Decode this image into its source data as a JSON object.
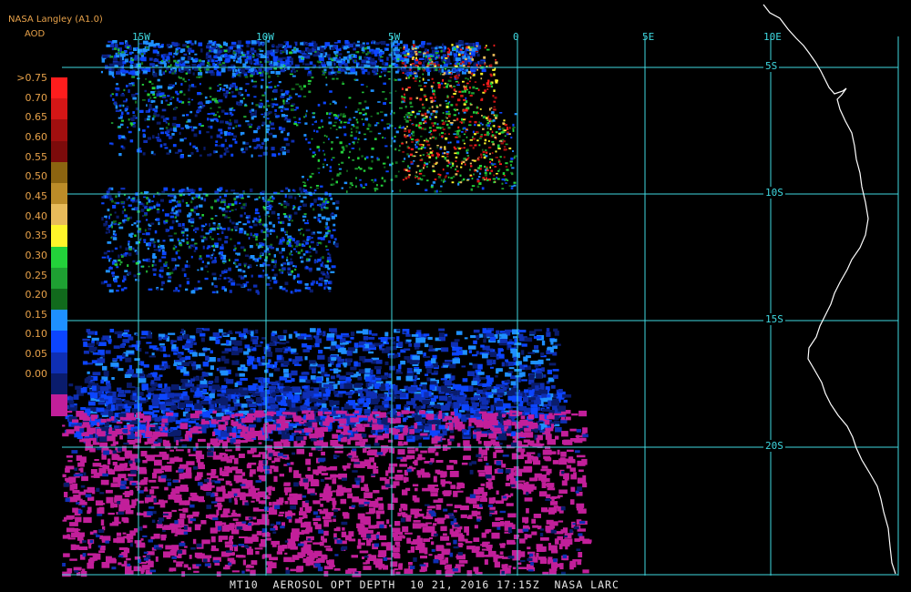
{
  "header": {
    "line1": "NASA Langley (A1.0)",
    "line2": "AOD"
  },
  "legend": {
    "labels": [
      ">0.75",
      "0.70",
      "0.65",
      "0.60",
      "0.55",
      "0.50",
      "0.45",
      "0.40",
      "0.35",
      "0.30",
      "0.25",
      "0.20",
      "0.15",
      "0.10",
      "0.05",
      "0.00"
    ],
    "colors": [
      "#ff1d1d",
      "#d51616",
      "#a10f0f",
      "#7c0b0b",
      "#8c6410",
      "#bc8c28",
      "#e8bb5a",
      "#fff52a",
      "#23d23a",
      "#1ea032",
      "#116a1c",
      "#1e90ff",
      "#0c45ff",
      "#0f2fb4",
      "#0a1c6c",
      "#c21f9a"
    ]
  },
  "grid": {
    "lon_labels": [
      "15W",
      "10W",
      "5W",
      "0",
      "5E",
      "10E"
    ],
    "lat_labels": [
      "5S",
      "10S",
      "15S",
      "20S"
    ]
  },
  "footer": {
    "text": "MT10  AEROSOL OPT DEPTH  10 21, 2016 17:15Z  NASA LARC"
  }
}
